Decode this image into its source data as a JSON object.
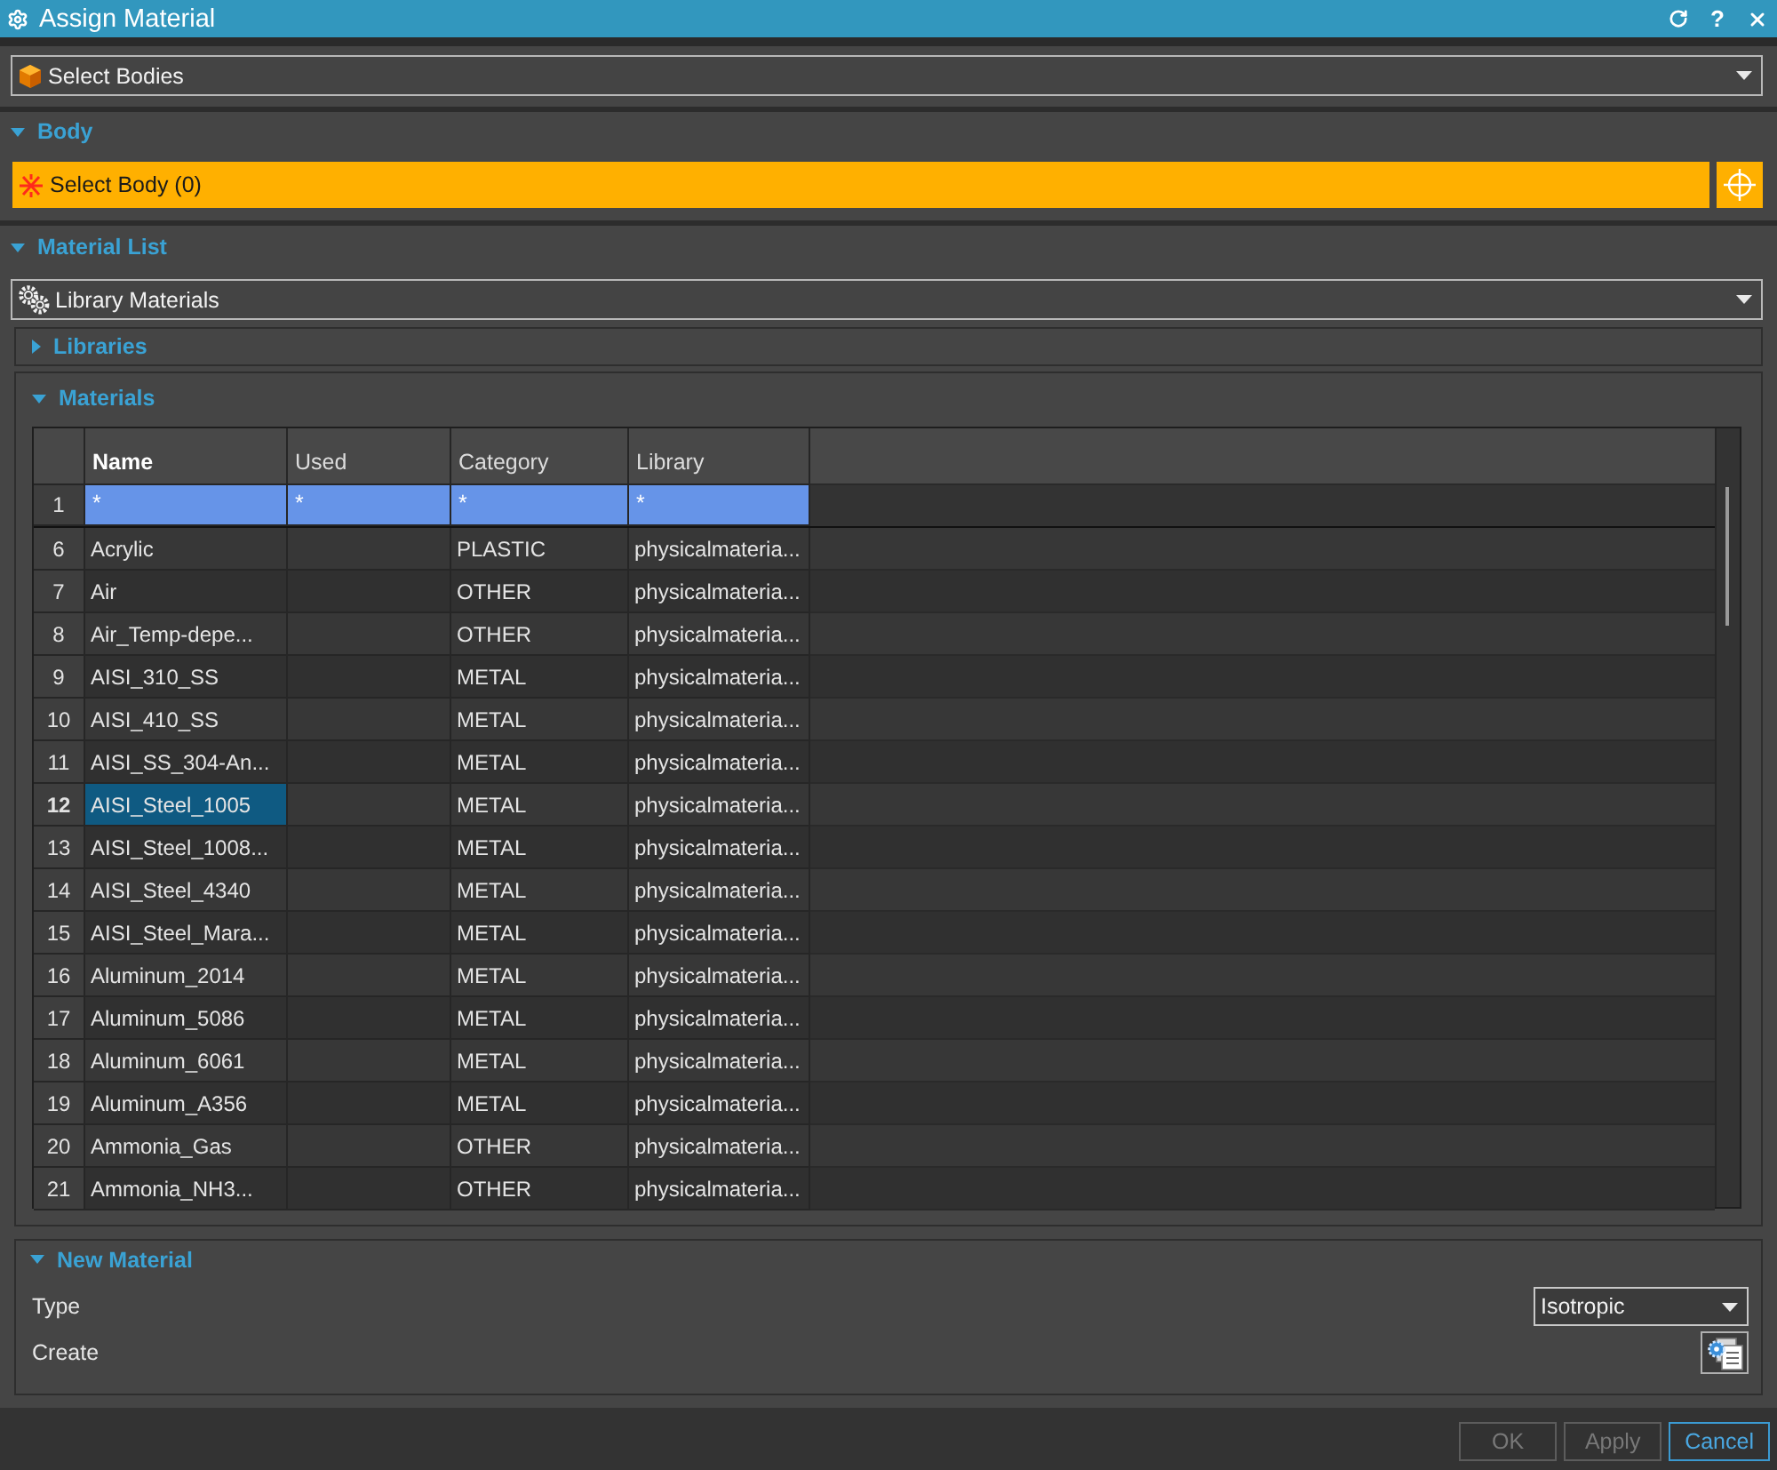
{
  "window": {
    "title": "Assign Material",
    "help": "?"
  },
  "select_bodies": {
    "value": "Select Bodies"
  },
  "body_section": {
    "title": "Body",
    "expanded": true,
    "selector": {
      "label": "Select Body (0)"
    }
  },
  "material_list_section": {
    "title": "Material List",
    "expanded": true,
    "source": {
      "value": "Library Materials"
    },
    "libraries": {
      "title": "Libraries",
      "expanded": false
    },
    "materials": {
      "title": "Materials",
      "expanded": true,
      "columns": [
        {
          "label": "Name",
          "selected": true
        },
        {
          "label": "Used",
          "selected": false
        },
        {
          "label": "Category",
          "selected": false
        },
        {
          "label": "Library",
          "selected": false
        }
      ],
      "filter_row": {
        "number": "1",
        "cells": [
          "*",
          "*",
          "*",
          "*"
        ]
      },
      "rows": [
        {
          "number": "6",
          "name": "Acrylic",
          "category": "PLASTIC",
          "library": "physicalmateria...",
          "selected": false
        },
        {
          "number": "7",
          "name": "Air",
          "category": "OTHER",
          "library": "physicalmateria...",
          "selected": false
        },
        {
          "number": "8",
          "name": "Air_Temp-depe...",
          "category": "OTHER",
          "library": "physicalmateria...",
          "selected": false
        },
        {
          "number": "9",
          "name": "AISI_310_SS",
          "category": "METAL",
          "library": "physicalmateria...",
          "selected": false
        },
        {
          "number": "10",
          "name": "AISI_410_SS",
          "category": "METAL",
          "library": "physicalmateria...",
          "selected": false
        },
        {
          "number": "11",
          "name": "AISI_SS_304-An...",
          "category": "METAL",
          "library": "physicalmateria...",
          "selected": false
        },
        {
          "number": "12",
          "name": "AISI_Steel_1005",
          "category": "METAL",
          "library": "physicalmateria...",
          "selected": true
        },
        {
          "number": "13",
          "name": "AISI_Steel_1008...",
          "category": "METAL",
          "library": "physicalmateria...",
          "selected": false
        },
        {
          "number": "14",
          "name": "AISI_Steel_4340",
          "category": "METAL",
          "library": "physicalmateria...",
          "selected": false
        },
        {
          "number": "15",
          "name": "AISI_Steel_Mara...",
          "category": "METAL",
          "library": "physicalmateria...",
          "selected": false
        },
        {
          "number": "16",
          "name": "Aluminum_2014",
          "category": "METAL",
          "library": "physicalmateria...",
          "selected": false
        },
        {
          "number": "17",
          "name": "Aluminum_5086",
          "category": "METAL",
          "library": "physicalmateria...",
          "selected": false
        },
        {
          "number": "18",
          "name": "Aluminum_6061",
          "category": "METAL",
          "library": "physicalmateria...",
          "selected": false
        },
        {
          "number": "19",
          "name": "Aluminum_A356",
          "category": "METAL",
          "library": "physicalmateria...",
          "selected": false
        },
        {
          "number": "20",
          "name": "Ammonia_Gas",
          "category": "OTHER",
          "library": "physicalmateria...",
          "selected": false
        },
        {
          "number": "21",
          "name": "Ammonia_NH3...",
          "category": "OTHER",
          "library": "physicalmateria...",
          "selected": false
        }
      ]
    }
  },
  "new_material_section": {
    "title": "New Material",
    "expanded": true,
    "type": {
      "label": "Type",
      "value": "Isotropic"
    },
    "create": {
      "label": "Create"
    }
  },
  "buttons": [
    {
      "label": "OK",
      "disabled": true
    },
    {
      "label": "Apply",
      "disabled": true
    },
    {
      "label": "Cancel",
      "disabled": false
    }
  ]
}
